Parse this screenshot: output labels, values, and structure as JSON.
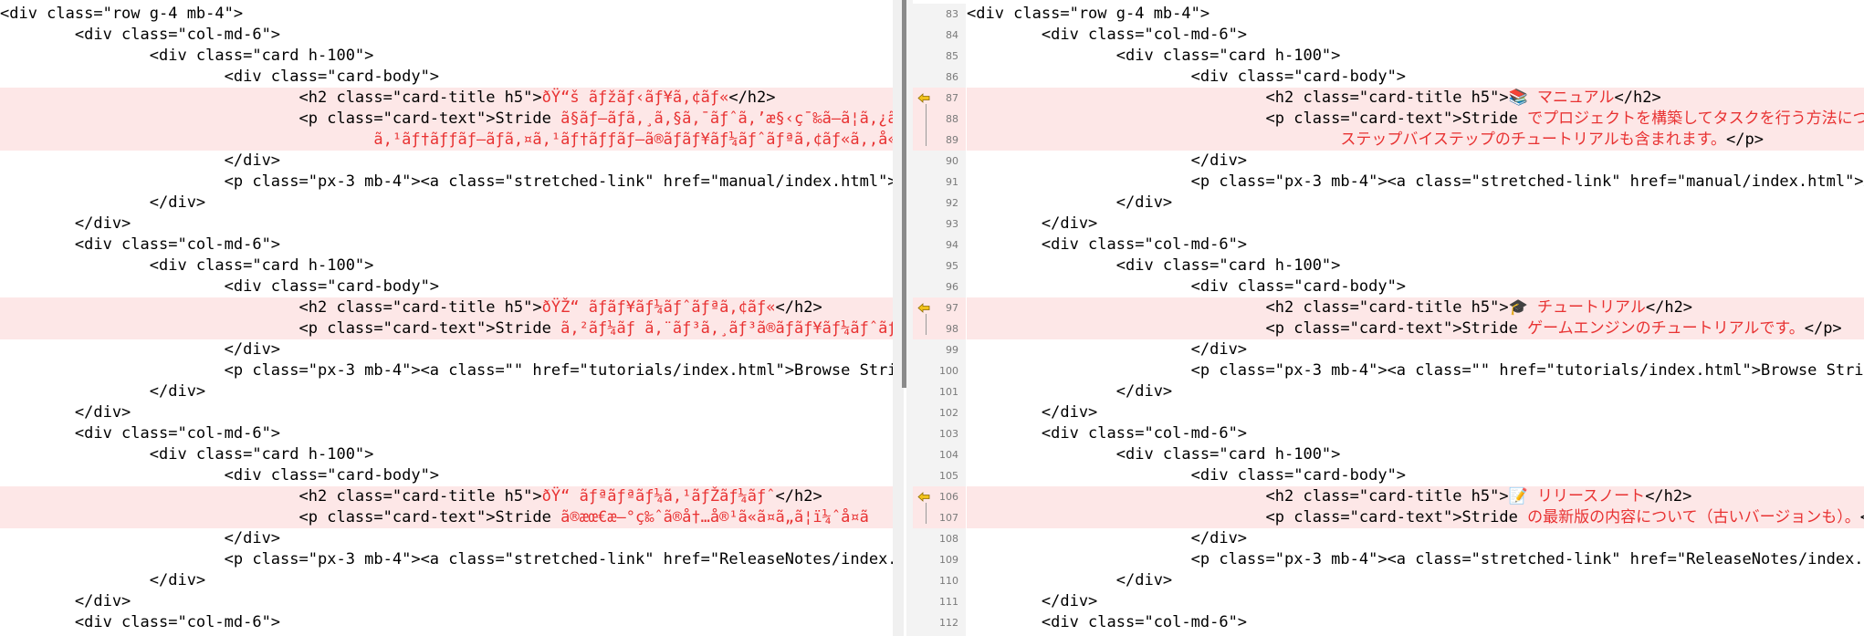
{
  "left": {
    "top_fragment": "...",
    "lines": [
      {
        "parts": [
          {
            "t": "<div class=\"row g-4 mb-4\">",
            "c": "n"
          }
        ]
      },
      {
        "parts": [
          {
            "t": "        <div class=\"col-md-6\">",
            "c": "n"
          }
        ]
      },
      {
        "parts": [
          {
            "t": "                <div class=\"card h-100\">",
            "c": "n"
          }
        ]
      },
      {
        "parts": [
          {
            "t": "                        <div class=\"card-body\">",
            "c": "n"
          }
        ]
      },
      {
        "diff": true,
        "parts": [
          {
            "t": "                                <h2 class=\"card-title h5\">",
            "c": "n"
          },
          {
            "t": "ðŸ“š ãƒžãƒ‹ãƒ¥ã‚¢ãƒ«",
            "c": "m"
          },
          {
            "t": "</h2>",
            "c": "n"
          }
        ]
      },
      {
        "diff": true,
        "parts": [
          {
            "t": "                                <p class=\"card-text\">Stride ",
            "c": "n"
          },
          {
            "t": "ã§ãƒ—ãƒ­ã‚¸ã‚§ã‚¯ãƒˆã‚’æ§‹ç¯‰ã—ã¦ã‚¿ã",
            "c": "m"
          }
        ]
      },
      {
        "diff": true,
        "parts": [
          {
            "t": "                                        ",
            "c": "n"
          },
          {
            "t": "ã‚¹ãƒ†ãƒƒãƒ—ãƒã‚¤ã‚¹ãƒ†ãƒƒãƒ—ã®ãƒãƒ¥ãƒ¼ãƒˆãƒªã‚¢ãƒ«ã‚‚å«ã",
            "c": "m"
          }
        ]
      },
      {
        "parts": [
          {
            "t": "                        </div>",
            "c": "n"
          }
        ]
      },
      {
        "parts": [
          {
            "t": "                        <p class=\"px-3 mb-4\"><a class=\"stretched-link\" href=\"manual/index.html\">Ac",
            "c": "n"
          }
        ]
      },
      {
        "parts": [
          {
            "t": "                </div>",
            "c": "n"
          }
        ]
      },
      {
        "parts": [
          {
            "t": "        </div>",
            "c": "n"
          }
        ]
      },
      {
        "parts": [
          {
            "t": "        <div class=\"col-md-6\">",
            "c": "n"
          }
        ]
      },
      {
        "parts": [
          {
            "t": "                <div class=\"card h-100\">",
            "c": "n"
          }
        ]
      },
      {
        "parts": [
          {
            "t": "                        <div class=\"card-body\">",
            "c": "n"
          }
        ]
      },
      {
        "diff": true,
        "parts": [
          {
            "t": "                                <h2 class=\"card-title h5\">",
            "c": "n"
          },
          {
            "t": "ðŸŽ“ ãƒãƒ¥ãƒ¼ãƒˆãƒªã‚¢ãƒ«",
            "c": "m"
          },
          {
            "t": "</h2>",
            "c": "n"
          }
        ]
      },
      {
        "diff": true,
        "parts": [
          {
            "t": "                                <p class=\"card-text\">Stride ",
            "c": "n"
          },
          {
            "t": "ã‚²ãƒ¼ãƒ ã‚¨ãƒ³ã‚¸ãƒ³ã®ãƒãƒ¥ãƒ¼ãƒˆãƒªã",
            "c": "m"
          }
        ]
      },
      {
        "parts": [
          {
            "t": "                        </div>",
            "c": "n"
          }
        ]
      },
      {
        "parts": [
          {
            "t": "                        <p class=\"px-3 mb-4\"><a class=\"\" href=\"tutorials/index.html\">Browse Stride",
            "c": "n"
          }
        ]
      },
      {
        "parts": [
          {
            "t": "                </div>",
            "c": "n"
          }
        ]
      },
      {
        "parts": [
          {
            "t": "        </div>",
            "c": "n"
          }
        ]
      },
      {
        "parts": [
          {
            "t": "        <div class=\"col-md-6\">",
            "c": "n"
          }
        ]
      },
      {
        "parts": [
          {
            "t": "                <div class=\"card h-100\">",
            "c": "n"
          }
        ]
      },
      {
        "parts": [
          {
            "t": "                        <div class=\"card-body\">",
            "c": "n"
          }
        ]
      },
      {
        "diff": true,
        "parts": [
          {
            "t": "                                <h2 class=\"card-title h5\">",
            "c": "n"
          },
          {
            "t": "ðŸ“ ãƒªãƒªãƒ¼ã‚¹ãƒŽãƒ¼ãƒˆ",
            "c": "m"
          },
          {
            "t": "</h2>",
            "c": "n"
          }
        ]
      },
      {
        "diff": true,
        "parts": [
          {
            "t": "                                <p class=\"card-text\">Stride ",
            "c": "n"
          },
          {
            "t": "ã®æœ€æ–°ç‰ˆã®å†…å®¹ã«ã¤ã„ã¦ï¼ˆå¤ã",
            "c": "m"
          }
        ]
      },
      {
        "parts": [
          {
            "t": "                        </div>",
            "c": "n"
          }
        ]
      },
      {
        "parts": [
          {
            "t": "                        <p class=\"px-3 mb-4\"><a class=\"stretched-link\" href=\"ReleaseNotes/index.ht",
            "c": "n"
          }
        ]
      },
      {
        "parts": [
          {
            "t": "                </div>",
            "c": "n"
          }
        ]
      },
      {
        "parts": [
          {
            "t": "        </div>",
            "c": "n"
          }
        ]
      },
      {
        "parts": [
          {
            "t": "        <div class=\"col-md-6\">",
            "c": "n"
          }
        ]
      }
    ]
  },
  "right": {
    "lines": [
      {
        "num": "83",
        "parts": [
          {
            "t": "<div class=\"row g-4 mb-4\">",
            "c": "n"
          }
        ]
      },
      {
        "num": "84",
        "parts": [
          {
            "t": "        <div class=\"col-md-6\">",
            "c": "n"
          }
        ]
      },
      {
        "num": "85",
        "parts": [
          {
            "t": "                <div class=\"card h-100\">",
            "c": "n"
          }
        ]
      },
      {
        "num": "86",
        "parts": [
          {
            "t": "                        <div class=\"card-body\">",
            "c": "n"
          }
        ]
      },
      {
        "num": "87",
        "diff": true,
        "arrow": true,
        "parts": [
          {
            "t": "                                <h2 class=\"card-title h5\">",
            "c": "n"
          },
          {
            "t": "📚 マニュアル",
            "c": "j"
          },
          {
            "t": "</h2>",
            "c": "n"
          }
        ]
      },
      {
        "num": "88",
        "diff": true,
        "parts": [
          {
            "t": "                                <p class=\"card-text\">Stride ",
            "c": "n"
          },
          {
            "t": "でプロジェクトを構築してタスクを行う方法について学び",
            "c": "j"
          }
        ]
      },
      {
        "num": "89",
        "diff": true,
        "parts": [
          {
            "t": "                                        ",
            "c": "n"
          },
          {
            "t": "ステップバイステップのチュートリアルも含まれます。",
            "c": "j"
          },
          {
            "t": "</p>",
            "c": "n"
          }
        ]
      },
      {
        "num": "90",
        "parts": [
          {
            "t": "                        </div>",
            "c": "n"
          }
        ]
      },
      {
        "num": "91",
        "parts": [
          {
            "t": "                        <p class=\"px-3 mb-4\"><a class=\"stretched-link\" href=\"manual/index.html\">Ac",
            "c": "n"
          }
        ]
      },
      {
        "num": "92",
        "parts": [
          {
            "t": "                </div>",
            "c": "n"
          }
        ]
      },
      {
        "num": "93",
        "parts": [
          {
            "t": "        </div>",
            "c": "n"
          }
        ]
      },
      {
        "num": "94",
        "parts": [
          {
            "t": "        <div class=\"col-md-6\">",
            "c": "n"
          }
        ]
      },
      {
        "num": "95",
        "parts": [
          {
            "t": "                <div class=\"card h-100\">",
            "c": "n"
          }
        ]
      },
      {
        "num": "96",
        "parts": [
          {
            "t": "                        <div class=\"card-body\">",
            "c": "n"
          }
        ]
      },
      {
        "num": "97",
        "diff": true,
        "arrow": true,
        "parts": [
          {
            "t": "                                <h2 class=\"card-title h5\">",
            "c": "n"
          },
          {
            "t": "🎓 チュートリアル",
            "c": "j"
          },
          {
            "t": "</h2>",
            "c": "n"
          }
        ]
      },
      {
        "num": "98",
        "diff": true,
        "parts": [
          {
            "t": "                                <p class=\"card-text\">Stride ",
            "c": "n"
          },
          {
            "t": "ゲームエンジンのチュートリアルです。",
            "c": "j"
          },
          {
            "t": "</p>",
            "c": "n"
          }
        ]
      },
      {
        "num": "99",
        "parts": [
          {
            "t": "                        </div>",
            "c": "n"
          }
        ]
      },
      {
        "num": "100",
        "parts": [
          {
            "t": "                        <p class=\"px-3 mb-4\"><a class=\"\" href=\"tutorials/index.html\">Browse Stride",
            "c": "n"
          }
        ]
      },
      {
        "num": "101",
        "parts": [
          {
            "t": "                </div>",
            "c": "n"
          }
        ]
      },
      {
        "num": "102",
        "parts": [
          {
            "t": "        </div>",
            "c": "n"
          }
        ]
      },
      {
        "num": "103",
        "parts": [
          {
            "t": "        <div class=\"col-md-6\">",
            "c": "n"
          }
        ]
      },
      {
        "num": "104",
        "parts": [
          {
            "t": "                <div class=\"card h-100\">",
            "c": "n"
          }
        ]
      },
      {
        "num": "105",
        "parts": [
          {
            "t": "                        <div class=\"card-body\">",
            "c": "n"
          }
        ]
      },
      {
        "num": "106",
        "diff": true,
        "arrow": true,
        "parts": [
          {
            "t": "                                <h2 class=\"card-title h5\">",
            "c": "n"
          },
          {
            "t": "📝 リリースノート",
            "c": "j"
          },
          {
            "t": "</h2>",
            "c": "n"
          }
        ]
      },
      {
        "num": "107",
        "diff": true,
        "parts": [
          {
            "t": "                                <p class=\"card-text\">Stride ",
            "c": "n"
          },
          {
            "t": "の最新版の内容について（古いバージョンも）。",
            "c": "j"
          },
          {
            "t": "</p>",
            "c": "n"
          }
        ]
      },
      {
        "num": "108",
        "parts": [
          {
            "t": "                        </div>",
            "c": "n"
          }
        ]
      },
      {
        "num": "109",
        "parts": [
          {
            "t": "                        <p class=\"px-3 mb-4\"><a class=\"stretched-link\" href=\"ReleaseNotes/index.ht",
            "c": "n"
          }
        ]
      },
      {
        "num": "110",
        "parts": [
          {
            "t": "                </div>",
            "c": "n"
          }
        ]
      },
      {
        "num": "111",
        "parts": [
          {
            "t": "        </div>",
            "c": "n"
          }
        ]
      },
      {
        "num": "112",
        "parts": [
          {
            "t": "        <div class=\"col-md-6\">",
            "c": "n"
          }
        ]
      }
    ]
  }
}
